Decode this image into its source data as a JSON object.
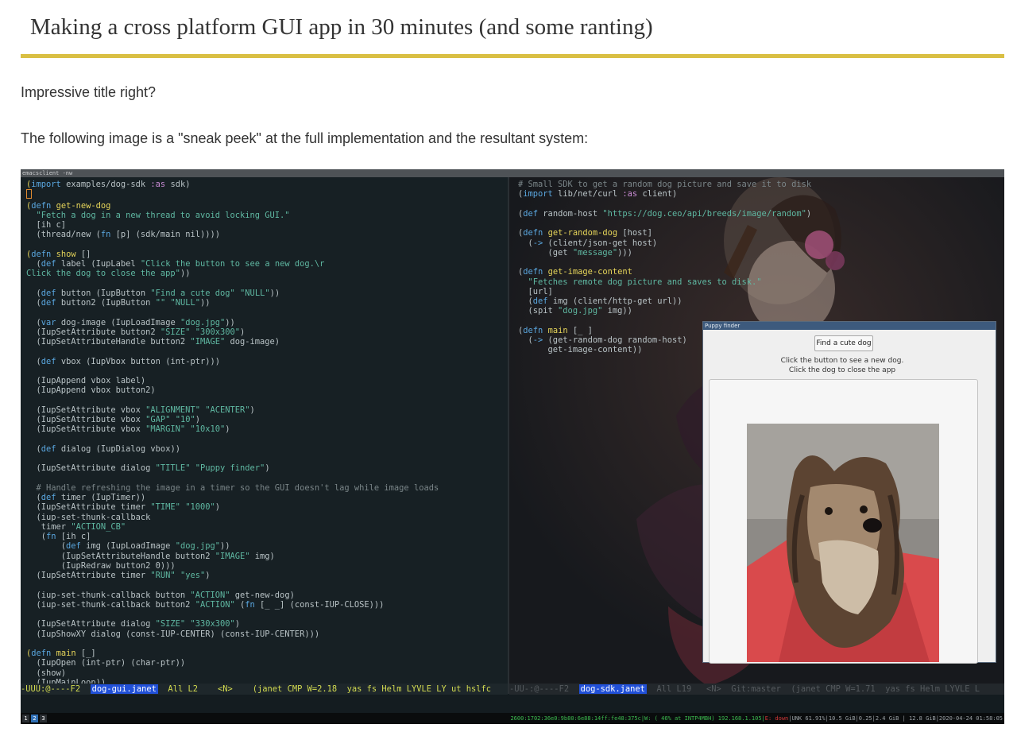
{
  "article": {
    "title": "Making a cross platform GUI app in 30 minutes (and some ranting)",
    "paragraph1": "Impressive title right?",
    "paragraph2": "The following image is a \"sneak peek\" at the full implementation and the resultant system:"
  },
  "screenshot": {
    "window_title": "emacsclient -nw",
    "left_pane": {
      "modeline_prefix": "-UUU:@----F2  ",
      "buffer_name": "dog-gui.janet",
      "modeline_suffix": "  All L2    <N>    (janet CMP W=2.18  yas fs Helm LYVLE LY ut hslfc"
    },
    "right_pane": {
      "modeline_prefix": "-UU-:@----F2  ",
      "buffer_name": "dog-sdk.janet",
      "modeline_suffix": "  All L19   <N>  Git:master  (janet CMP W=1.71  yas fs Helm LYVLE L"
    },
    "bottom_bar": {
      "workspaces": [
        "1",
        "2",
        "3"
      ],
      "active_workspace": "2",
      "status_net": "2600:1702:36e0:9b80:6e88:14ff:fe48:375c|W: ( 46% at INTP4MBH) 192.168.1.105|",
      "status_down": "E: down",
      "status_rest": "|UNK 61.91%|10.5 GiB|0.25|2.4 GiB | 12.8 GiB|2020-04-24 01:58:05"
    },
    "puppy_window": {
      "title": "Puppy finder",
      "button_label": "Find a cute dog",
      "label_line1": "Click the button to see a new dog.",
      "label_line2": "Click the dog to close the app"
    }
  },
  "colors": {
    "accent_rule": "#d9bf43",
    "editor_bg": "#172024",
    "keyword": "#5aa7e0",
    "function_name": "#e6d55a",
    "string": "#5fb8a2",
    "buffer_highlight": "#2150d8"
  }
}
